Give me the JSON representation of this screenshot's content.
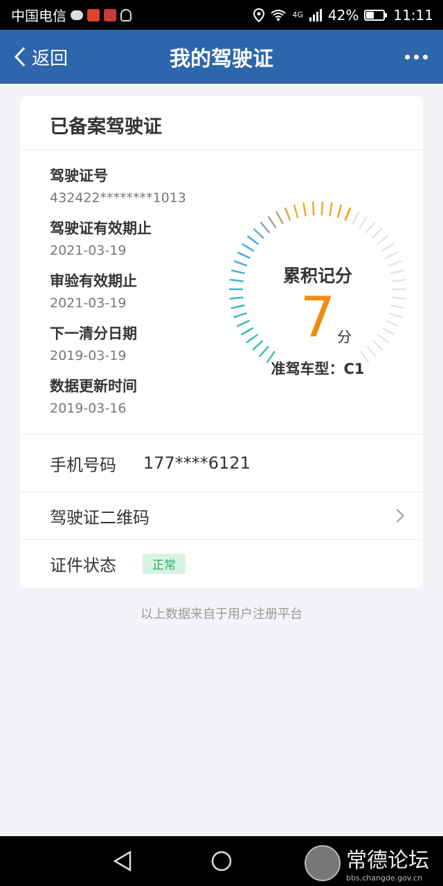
{
  "status_bar": {
    "carrier": "中国电信",
    "network": "4G",
    "battery": "42%",
    "time": "11:11",
    "left_icons": [
      "chat-bubble-icon",
      "video-app-icon",
      "reader-app-icon",
      "ghost-app-icon"
    ],
    "right_icons": [
      "location-icon",
      "wifi-icon",
      "signal-icon",
      "battery-icon"
    ]
  },
  "nav": {
    "back_label": "返回",
    "title": "我的驾驶证",
    "more_icon": "more-dots-icon"
  },
  "card": {
    "title": "已备案驾驶证",
    "fields": [
      {
        "label": "驾驶证号",
        "value": "432422********1013"
      },
      {
        "label": "驾驶证有效期止",
        "value": "2021-03-19"
      },
      {
        "label": "审验有效期止",
        "value": "2021-03-19"
      },
      {
        "label": "下一清分日期",
        "value": "2019-03-19"
      },
      {
        "label": "数据更新时间",
        "value": "2019-03-16"
      }
    ],
    "score": {
      "label": "累积记分",
      "value": 7,
      "unit": "分",
      "max": 12,
      "colors": {
        "low": "#36c5a3",
        "mid": "#47a9e3",
        "high": "#f5a623",
        "track": "#e4e4e4"
      }
    },
    "license_class": "准驾车型：C1",
    "phone": {
      "label": "手机号码",
      "value": "177****6121"
    },
    "qr": {
      "label": "驾驶证二维码"
    },
    "status": {
      "label": "证件状态",
      "value": "正常",
      "color": "#2fae68"
    }
  },
  "footer_note": "以上数据来自于用户注册平台",
  "system_nav": {
    "icons": [
      "back-triangle-icon",
      "home-circle-icon",
      "recents-square-icon"
    ]
  },
  "watermark": {
    "title": "常德论坛",
    "url": "bbs.changde.gov.cn"
  }
}
